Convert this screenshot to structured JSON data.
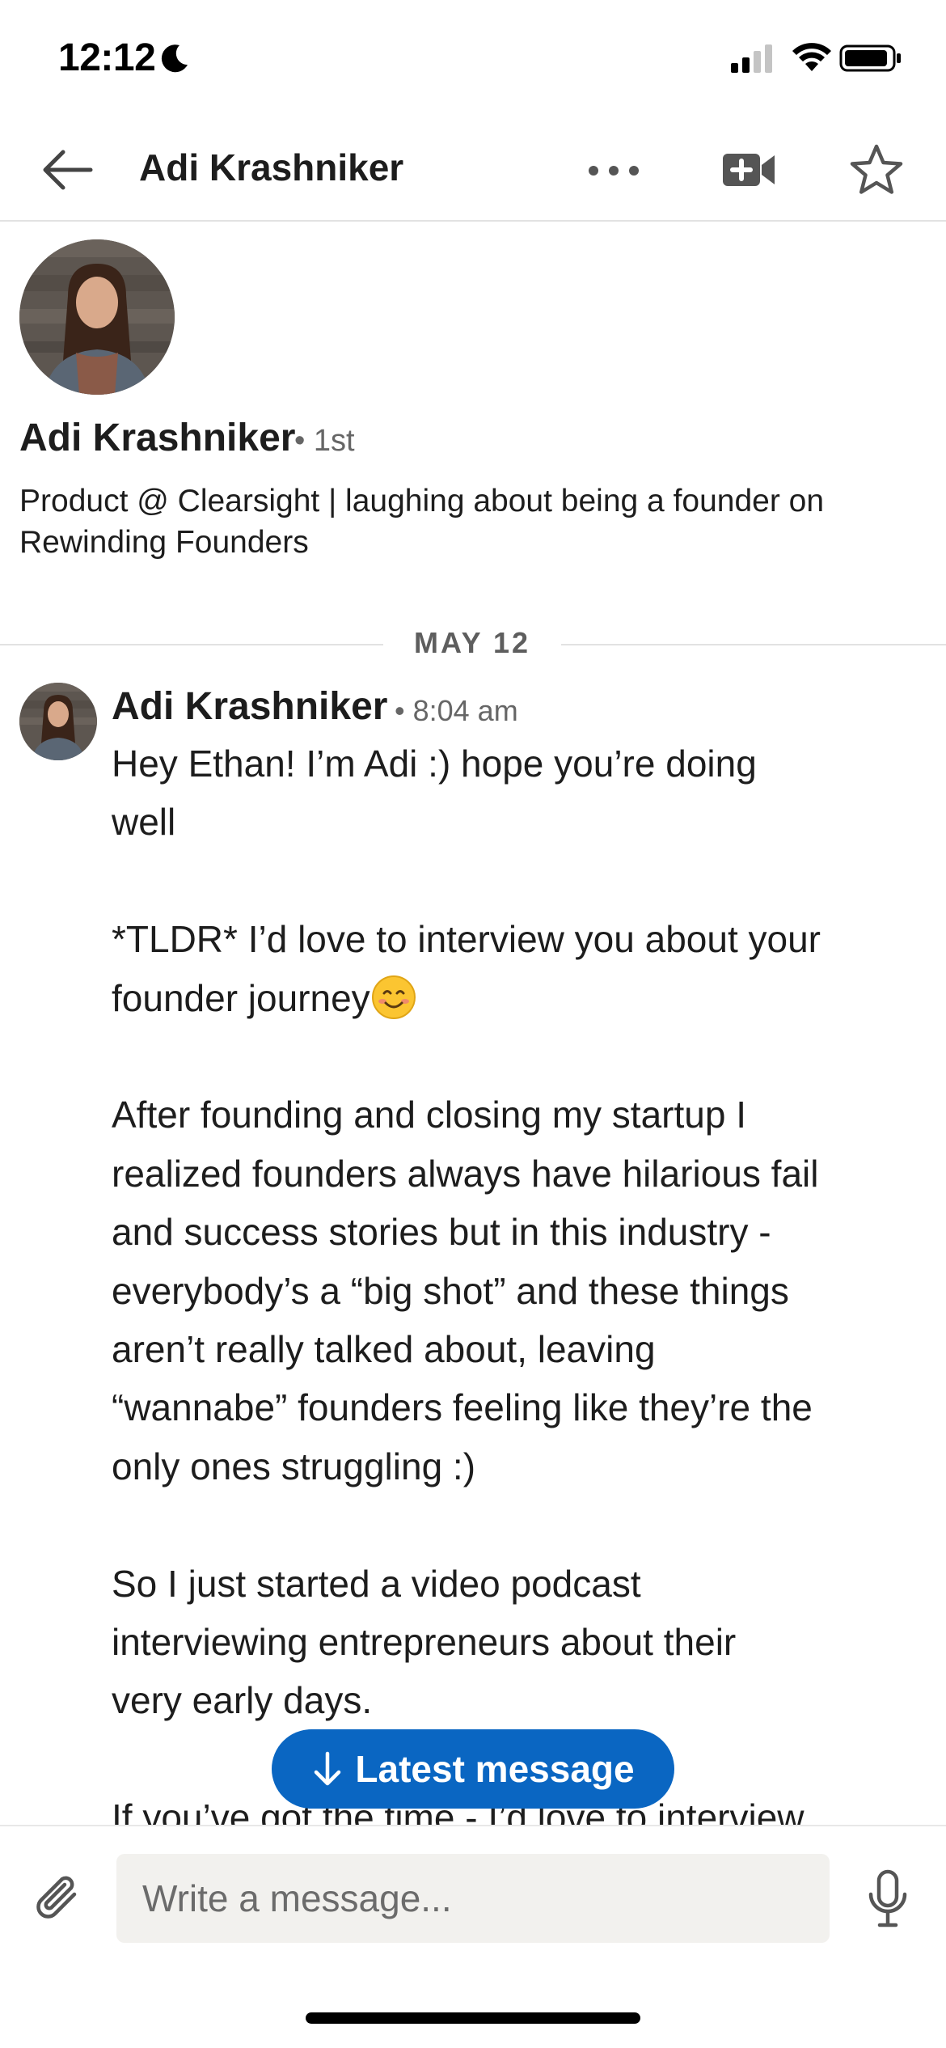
{
  "status_bar": {
    "time": "12:12",
    "icons": [
      "moon-icon",
      "cellular-signal-icon",
      "wifi-icon",
      "battery-icon"
    ]
  },
  "header": {
    "title": "Adi Krashniker",
    "icons": [
      "back-arrow-icon",
      "more-options-icon",
      "add-video-icon",
      "star-icon"
    ]
  },
  "profile": {
    "name": "Adi Krashniker",
    "degree": "• 1st",
    "headline": "Product @ Clearsight | laughing about being a founder on Rewinding Founders"
  },
  "conversation": {
    "date_label": "MAY 12",
    "message": {
      "sender": "Adi Krashniker",
      "time": "• 8:04 am",
      "paragraphs": [
        "Hey Ethan! I’m Adi :) hope you’re doing\nwell",
        "*TLDR* I’d love to interview you about your\nfounder journey",
        "After founding and closing my startup I\nrealized founders always have hilarious fail\nand success stories but in this industry -\neverybody’s a “big shot” and these things\naren’t really talked about, leaving\n“wannabe” founders feeling like they’re the\nonly ones struggling :)",
        "So I just started a video podcast\ninterviewing entrepreneurs about their\nvery early days.",
        "If you’ve got the time - I’d love to interview"
      ],
      "emoji": "smiling-face-emoji"
    }
  },
  "latest_button": {
    "label": "Latest message"
  },
  "composer": {
    "placeholder": "Write a message...",
    "value": ""
  },
  "colors": {
    "accent": "#0a66c2",
    "text": "#1d1d1d",
    "secondary_text": "#666666",
    "divider": "#e2e2e2",
    "input_bg": "#f2f1ee"
  }
}
